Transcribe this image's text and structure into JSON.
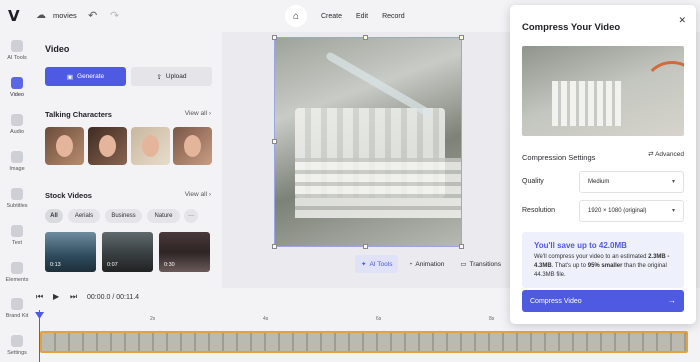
{
  "topbar": {
    "logo": "V",
    "project_name": "movies",
    "menu": [
      "Create",
      "Edit",
      "Record"
    ]
  },
  "rail": [
    {
      "label": "AI Tools",
      "icon": "sparkle-icon"
    },
    {
      "label": "Video",
      "icon": "video-icon",
      "active": true
    },
    {
      "label": "Audio",
      "icon": "music-icon"
    },
    {
      "label": "Image",
      "icon": "image-icon"
    },
    {
      "label": "Subtitles",
      "icon": "subtitles-icon"
    },
    {
      "label": "Text",
      "icon": "text-icon"
    },
    {
      "label": "Elements",
      "icon": "elements-icon"
    },
    {
      "label": "Brand Kit",
      "icon": "brand-icon"
    },
    {
      "label": "Settings",
      "icon": "gear-icon"
    }
  ],
  "panel": {
    "title": "Video",
    "generate_label": "Generate",
    "upload_label": "Upload",
    "talking_title": "Talking Characters",
    "stock_title": "Stock Videos",
    "view_all": "View all",
    "filters": [
      "All",
      "Aerials",
      "Business",
      "Nature",
      "···"
    ],
    "stock_durations": [
      "0:13",
      "0:07",
      "0:30"
    ]
  },
  "canvas": {
    "tools": [
      "AI Tools",
      "Animation",
      "Transitions"
    ]
  },
  "playback": {
    "current_time": "00:00.0",
    "separator": "/",
    "total_time": "00:11.4"
  },
  "timeline": {
    "ruler": [
      "2x",
      "4s",
      "6s",
      "8s"
    ]
  },
  "modal": {
    "title": "Compress Your Video",
    "settings_title": "Compression Settings",
    "advanced_label": "Advanced",
    "quality_label": "Quality",
    "quality_value": "Medium",
    "resolution_label": "Resolution",
    "resolution_value": "1920 × 1080 (original)",
    "save_headline": "You'll save up to 42.0MB",
    "save_text_1": "We'll compress your video to an estimated ",
    "save_bold_1": "2.3MB - 4.3MB",
    "save_text_2": ". That's up to ",
    "save_bold_2": "95% smaller",
    "save_text_3": " than the original 44.3MB file.",
    "button_label": "Compress Video"
  },
  "colors": {
    "accent": "#4f5ae2",
    "timeline_border": "#e3a23e"
  }
}
